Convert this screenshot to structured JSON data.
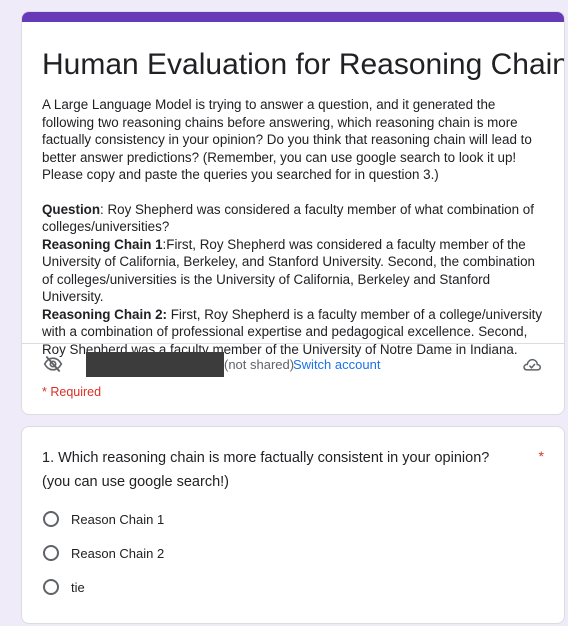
{
  "form": {
    "title": "Human Evaluation for Reasoning Chains",
    "intro": "A Large Language Model is trying to answer a question, and it generated the following two reasoning chains before answering, which reasoning chain is more factually consistency in your opinion? Do you think that reasoning chain will lead to better answer predictions? (Remember, you can use google search to look it up! Please copy and paste the queries you searched for in question 3.)",
    "question_label": "Question",
    "question_text": ": Roy Shepherd was considered a faculty member of what combination of colleges/universities?",
    "chain1_label": "Reasoning Chain 1",
    "chain1_text": ":First, Roy Shepherd was considered a faculty member of the University of California, Berkeley, and Stanford University. Second, the combination of colleges/universities is the University of California, Berkeley and Stanford University.",
    "chain2_label": "Reasoning Chain 2:",
    "chain2_text": " First, Roy Shepherd is a faculty member of a college/university with a combination of professional expertise and pedagogical excellence. Second, Roy Shepherd was a faculty member of the University of Notre Dame in Indiana."
  },
  "account": {
    "not_shared": "(not shared)",
    "switch_label": "Switch account",
    "eye_icon": "eye-off-icon",
    "cloud_icon": "cloud-saved-icon"
  },
  "required_label": "* Required",
  "question1": {
    "text": "1. Which reasoning chain is more factually consistent in your opinion? (you can use google search!)",
    "required_star": "*",
    "options": [
      "Reason Chain 1",
      "Reason Chain 2",
      "tie"
    ]
  },
  "colors": {
    "accent": "#673ab7",
    "background": "#f0ebf8",
    "link": "#1a73e8",
    "required": "#d93025"
  }
}
